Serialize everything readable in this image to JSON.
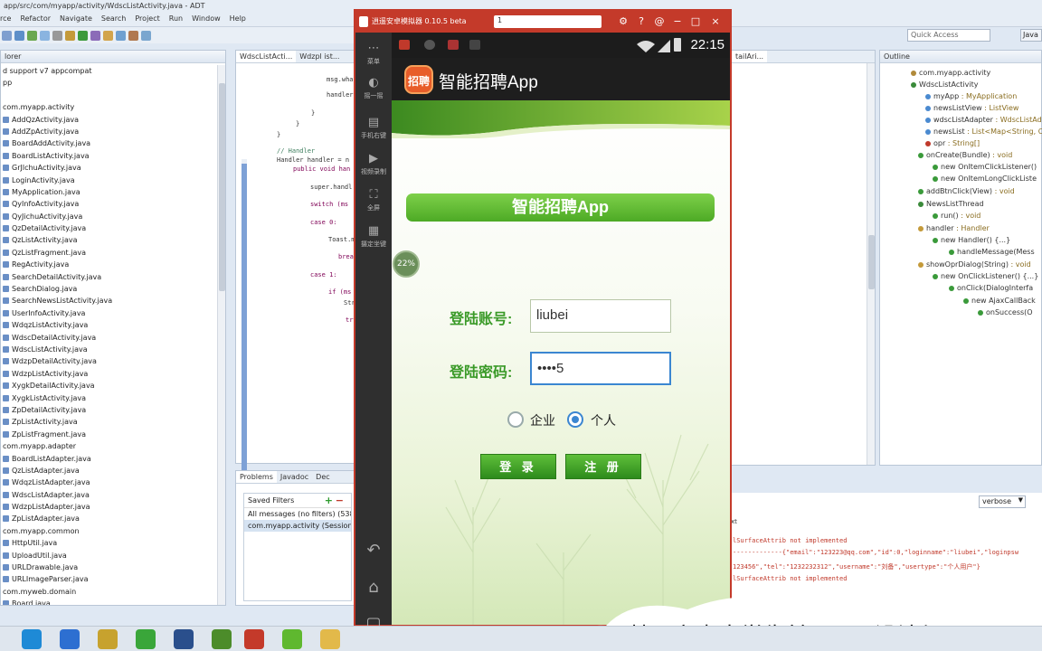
{
  "window": {
    "path_title": "app/src/com/myapp/activity/WdscListActivity.java - ADT",
    "menus": [
      "rce",
      "Refactor",
      "Navigate",
      "Search",
      "Project",
      "Run",
      "Window",
      "Help"
    ],
    "quick_access_placeholder": "Quick Access",
    "perspective": "Java"
  },
  "package_explorer": {
    "title": "lorer",
    "items": [
      "d support v7 appcompat",
      "pp",
      "",
      "com.myapp.activity",
      "AddQzActivity.java",
      "AddZpActivity.java",
      "BoardAddActivity.java",
      "BoardListActivity.java",
      "GrJlchuActivity.java",
      "LoginActivity.java",
      "MyApplication.java",
      "QyInfoActivity.java",
      "QyJichuActivity.java",
      "QzDetailActivity.java",
      "QzListActivity.java",
      "QzListFragment.java",
      "RegActivity.java",
      "SearchDetailActivity.java",
      "SearchDialog.java",
      "SearchNewsListActivity.java",
      "UserInfoActivity.java",
      "WdqzListActivity.java",
      "WdscDetailActivity.java",
      "WdscListActivity.java",
      "WdzpDetailActivity.java",
      "WdzpListActivity.java",
      "XygkDetailActivity.java",
      "XygkListActivity.java",
      "ZpDetailActivity.java",
      "ZpListActivity.java",
      "ZpListFragment.java",
      "com.myapp.adapter",
      "BoardListAdapter.java",
      "QzListAdapter.java",
      "WdqzListAdapter.java",
      "WdscListAdapter.java",
      "WdzpListAdapter.java",
      "ZpListAdapter.java",
      "com.myapp.common",
      "HttpUtil.java",
      "UploadUtil.java",
      "URLDrawable.java",
      "URLImageParser.java",
      "com.myweb.domain",
      "Board.java"
    ]
  },
  "editor": {
    "tabs": [
      "WdscListActi...",
      "Wdzpl ist..."
    ],
    "lines": [
      {
        "t": "msg.wha",
        "k": "n"
      },
      {
        "t": "handler",
        "k": "n"
      },
      {
        "t": "}",
        "k": "n"
      },
      {
        "t": "}",
        "k": "n"
      },
      {
        "t": "}",
        "k": "n"
      },
      {
        "t": "// Handler",
        "k": "c"
      },
      {
        "t": "Handler handler = n",
        "k": "n"
      },
      {
        "t": "public void han",
        "k": "k"
      },
      {
        "t": "super.handl",
        "k": "n"
      },
      {
        "t": "switch (ms",
        "k": "k"
      },
      {
        "t": "case 0:",
        "k": "k"
      },
      {
        "t": "Toast.m",
        "k": "n"
      },
      {
        "t": "break;",
        "k": "k"
      },
      {
        "t": "case 1:",
        "k": "k"
      },
      {
        "t": "if (ms",
        "k": "k"
      },
      {
        "t": "Str",
        "k": "n"
      },
      {
        "t": "try",
        "k": "k"
      }
    ]
  },
  "editor2": {
    "tabs": [
      "tailAri..."
    ]
  },
  "outline": {
    "title": "Outline",
    "rows": [
      {
        "label": "com.myapp.activity",
        "detail": ""
      },
      {
        "label": "WdscListActivity",
        "detail": ""
      },
      {
        "label": "myApp",
        "detail": " : MyApplication"
      },
      {
        "label": "newsListView",
        "detail": " : ListView"
      },
      {
        "label": "wdscListAdapter",
        "detail": " : WdscListAd"
      },
      {
        "label": "newsList",
        "detail": " : List<Map<String, O"
      },
      {
        "label": "opr",
        "detail": " : String[]"
      },
      {
        "label": "onCreate(Bundle)",
        "detail": " : void"
      },
      {
        "label": "new OnItemClickListener()",
        "detail": ""
      },
      {
        "label": "new OnItemLongClickListe",
        "detail": ""
      },
      {
        "label": "addBtnClick(View)",
        "detail": " : void"
      },
      {
        "label": "NewsListThread",
        "detail": ""
      },
      {
        "label": "run()",
        "detail": " : void"
      },
      {
        "label": "handler",
        "detail": " : Handler"
      },
      {
        "label": "new Handler() {...}",
        "detail": ""
      },
      {
        "label": "handleMessage(Mess",
        "detail": ""
      },
      {
        "label": "showOprDialog(String)",
        "detail": " : void"
      },
      {
        "label": "new OnClickListener() {...}",
        "detail": ""
      },
      {
        "label": "onClick(DialogInterfa",
        "detail": ""
      },
      {
        "label": "new AjaxCallBack",
        "detail": ""
      },
      {
        "label": "onSuccess(O",
        "detail": ""
      }
    ]
  },
  "problems": {
    "tabs": [
      "Problems",
      "Javadoc",
      "Dec"
    ],
    "saved_filters_title": "Saved Filters",
    "filters": [
      "All messages (no filters) (538",
      "com.myapp.activity (Session f"
    ]
  },
  "console": {
    "level": "verbose",
    "header": "xt",
    "lines": [
      "lSurfaceAttrib not implemented",
      "-------------{\"email\":\"123223@qq.com\",\"id\":0,\"loginname\":\"liubei\",\"loginpsw",
      "123456\",\"tel\":\"1232232312\",\"username\":\"刘备\",\"usertype\":\"个人用户\"}",
      "lSurfaceAttrib not implemented"
    ]
  },
  "emulator": {
    "title": "逍遥安卓模拟器 0.10.5 beta",
    "search_value": "1",
    "side_buttons": [
      "菜单",
      "摇一摇",
      "手机右键",
      "视频录制",
      "全屏",
      "摄定坐键"
    ],
    "statusbar_time": "22:15",
    "app_icon_text": "招聘",
    "app_title": "智能招聘App",
    "banner": "智能招聘App",
    "progress_badge": "22%",
    "form": {
      "account_label": "登陆账号:",
      "account_value": "liubei",
      "password_label": "登陆密码:",
      "password_value": "••••5"
    },
    "radio": {
      "options": [
        "企业",
        "个人"
      ],
      "selected": "个人"
    },
    "buttons": {
      "login": "登 录",
      "register": "注 册"
    }
  },
  "caption": "基于安卓大学生兼职APP设计与"
}
